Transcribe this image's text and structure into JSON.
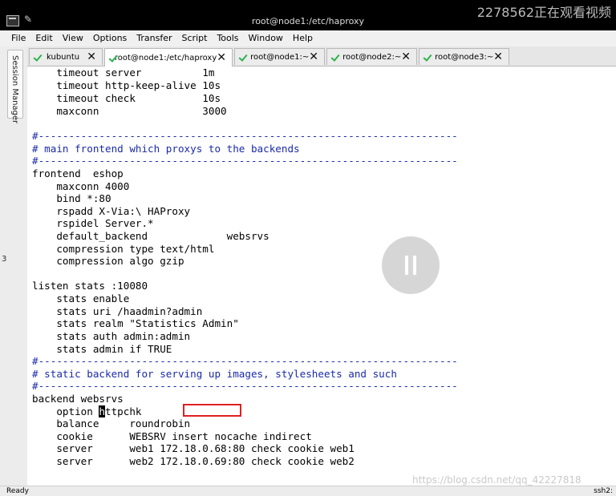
{
  "titlebar": {
    "title": "root@node1:/etc/haproxy",
    "overlay_text": "2278562正在观看视频",
    "icons": [
      "app-icon",
      "pin-icon"
    ]
  },
  "menu": [
    "File",
    "Edit",
    "View",
    "Options",
    "Transfer",
    "Script",
    "Tools",
    "Window",
    "Help"
  ],
  "sidebar": {
    "tab_label": "Session Manager"
  },
  "tabs": [
    {
      "label": "kubuntu",
      "active": false,
      "icon": "check-icon"
    },
    {
      "label": "root@node1:/etc/haproxy",
      "active": true,
      "icon": "check-icon"
    },
    {
      "label": "root@node1:~",
      "active": false,
      "icon": "check-icon"
    },
    {
      "label": "root@node2:~",
      "active": false,
      "icon": "check-icon"
    },
    {
      "label": "root@node3:~",
      "active": false,
      "icon": "check-icon"
    }
  ],
  "terminal": {
    "lines": [
      "    timeout server          1m",
      "    timeout http-keep-alive 10s",
      "    timeout check           10s",
      "    maxconn                 3000",
      "",
      "#---------------------------------------------------------------------",
      "# main frontend which proxys to the backends",
      "#---------------------------------------------------------------------",
      "frontend  eshop",
      "    maxconn 4000",
      "    bind *:80",
      "    rspadd X-Via:\\ HAProxy",
      "    rspidel Server.*",
      "    default_backend             websrvs",
      "    compression type text/html",
      "    compression algo gzip",
      "",
      "listen stats :10080",
      "    stats enable",
      "    stats uri /haadmin?admin",
      "    stats realm \"Statistics Admin\"",
      "    stats auth admin:admin",
      "    stats admin if TRUE",
      "#---------------------------------------------------------------------",
      "# static backend for serving up images, stylesheets and such",
      "#---------------------------------------------------------------------",
      "backend websrvs",
      "    option ",
      "    balance     roundrobin",
      "    cookie      WEBSRV insert nocache indirect",
      "    server      web1 172.18.0.68:80 check cookie web1",
      "    server      web2 172.18.0.69:80 check cookie web2"
    ],
    "cursor_line": {
      "prefix": "    option ",
      "cursor_char": "h",
      "suffix": "ttpchk"
    },
    "comment_color": "#1a2aa8"
  },
  "edge_mark": "3",
  "watermark": "https://blog.csdn.net/qq_42227818",
  "statusbar": {
    "left": "Ready",
    "right": "ssh2:"
  }
}
